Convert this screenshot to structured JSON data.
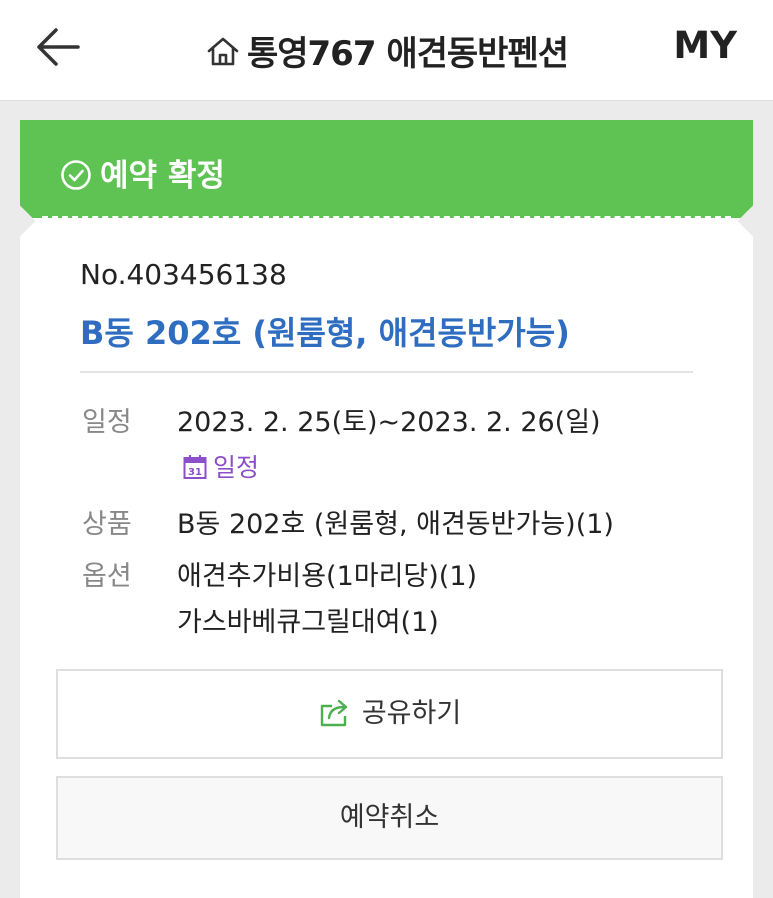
{
  "header": {
    "back_icon": "arrow-left-icon",
    "home_icon": "home-icon",
    "title": "통영767 애견동반펜션",
    "my_label": "MY"
  },
  "status": {
    "icon": "check-circle-icon",
    "label": "예약 확정",
    "color": "#5ec352"
  },
  "booking": {
    "number": "No.403456138",
    "room_title": "B동 202호 (원룸형, 애견동반가능)",
    "title_color": "#2e6dc0",
    "details": {
      "schedule_label": "일정",
      "schedule_value": "2023. 2. 25(토)~2023. 2. 26(일)",
      "calendar_icon_text": "31",
      "calendar_link": "일정",
      "product_label": "상품",
      "product_value": "B동 202호 (원룸형, 애견동반가능)(1)",
      "option_label": "옵션",
      "options": [
        "애견추가비용(1마리당)(1)",
        "가스바베큐그릴대여(1)"
      ]
    }
  },
  "actions": {
    "share_icon": "share-icon",
    "share_label": "공유하기",
    "cancel_label": "예약취소"
  }
}
